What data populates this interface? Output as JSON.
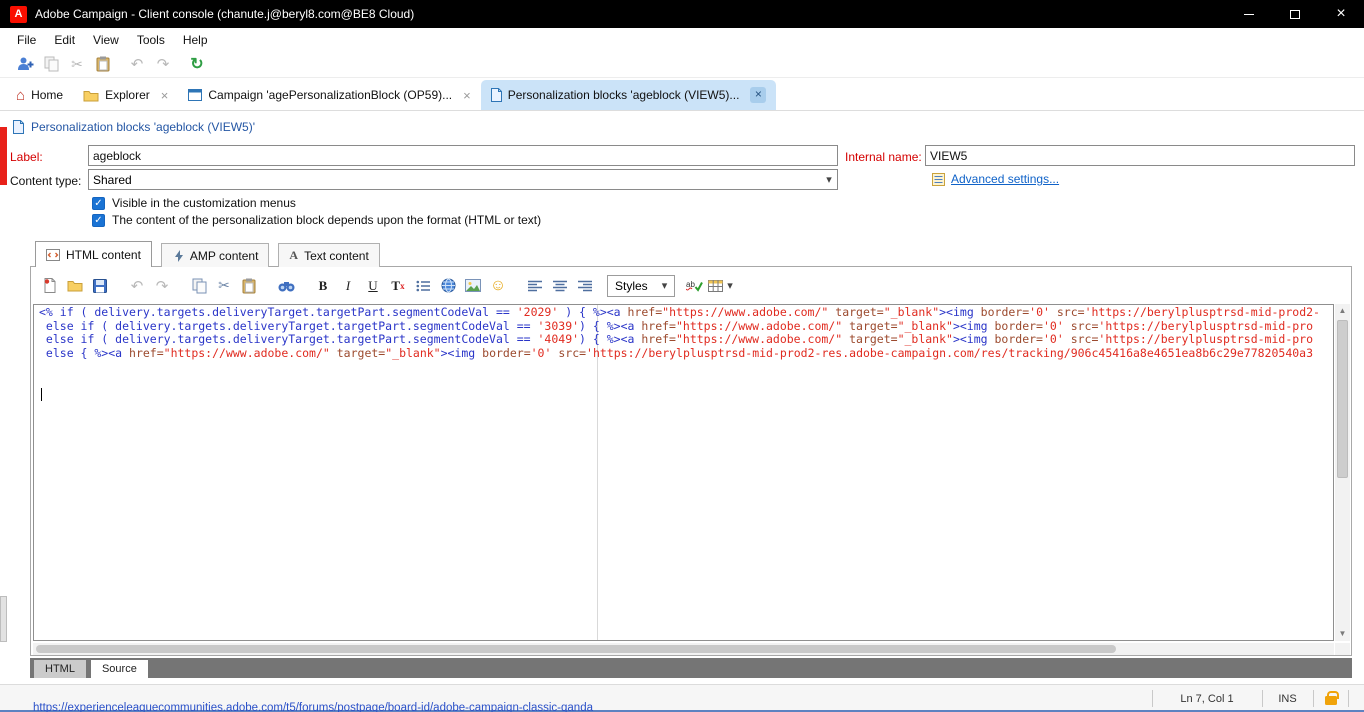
{
  "window": {
    "title": "Adobe Campaign - Client console (chanute.j@beryl8.com@BE8 Cloud)",
    "logo_letter": "A"
  },
  "menubar": {
    "items": [
      "File",
      "Edit",
      "View",
      "Tools",
      "Help"
    ]
  },
  "workspace_tabs": {
    "home": "Home",
    "explorer": "Explorer",
    "campaign": "Campaign 'agePersonalizationBlock (OP59)...",
    "personalization": "Personalization blocks 'ageblock (VIEW5)..."
  },
  "breadcrumb": {
    "title": "Personalization blocks 'ageblock (VIEW5)'"
  },
  "form": {
    "label_caption": "Label:",
    "label_value": "ageblock",
    "internal_name_caption": "Internal name:",
    "internal_name_value": "VIEW5",
    "content_type_caption": "Content type:",
    "content_type_value": "Shared",
    "advanced_settings_label": "Advanced settings...",
    "visible_checkbox_label": "Visible in the customization menus",
    "format_checkbox_label": "The content of the personalization block depends upon the format (HTML or text)"
  },
  "content_tabs": {
    "html": "HTML content",
    "amp": "AMP content",
    "text": "Text content"
  },
  "editor_toolbar": {
    "bold_label": "B",
    "italic_label": "I",
    "underline_label": "U",
    "remove_format_label": "T",
    "remove_format_sub": "x",
    "styles_label": "Styles"
  },
  "editor": {
    "caret": {
      "line": 7,
      "col": 1
    },
    "code_lines": [
      [
        {
          "c": "kw",
          "t": "<% if ( delivery.targets.deliveryTarget.targetPart.segmentCodeVal == "
        },
        {
          "c": "str",
          "t": "'2029'"
        },
        {
          "c": "kw",
          "t": " ) { %><a "
        },
        {
          "c": "attr",
          "t": "href="
        },
        {
          "c": "str",
          "t": "\"https://www.adobe.com/\""
        },
        {
          "c": "pl",
          "t": " "
        },
        {
          "c": "attr",
          "t": "target="
        },
        {
          "c": "str",
          "t": "\"_blank\""
        },
        {
          "c": "kw",
          "t": "><img "
        },
        {
          "c": "attr",
          "t": "border="
        },
        {
          "c": "str",
          "t": "'0'"
        },
        {
          "c": "pl",
          "t": " "
        },
        {
          "c": "attr",
          "t": "src="
        },
        {
          "c": "str",
          "t": "'https://berylplusptrsd-mid-prod2-"
        }
      ],
      [
        {
          "c": "kw",
          "t": " else if ( delivery.targets.deliveryTarget.targetPart.segmentCodeVal == "
        },
        {
          "c": "str",
          "t": "'3039'"
        },
        {
          "c": "kw",
          "t": ") { %><a "
        },
        {
          "c": "attr",
          "t": "href="
        },
        {
          "c": "str",
          "t": "\"https://www.adobe.com/\""
        },
        {
          "c": "pl",
          "t": " "
        },
        {
          "c": "attr",
          "t": "target="
        },
        {
          "c": "str",
          "t": "\"_blank\""
        },
        {
          "c": "kw",
          "t": "><img "
        },
        {
          "c": "attr",
          "t": "border="
        },
        {
          "c": "str",
          "t": "'0'"
        },
        {
          "c": "pl",
          "t": " "
        },
        {
          "c": "attr",
          "t": "src="
        },
        {
          "c": "str",
          "t": "'https://berylplusptrsd-mid-pro"
        }
      ],
      [
        {
          "c": "kw",
          "t": " else if ( delivery.targets.deliveryTarget.targetPart.segmentCodeVal == "
        },
        {
          "c": "str",
          "t": "'4049'"
        },
        {
          "c": "kw",
          "t": ") { %><a "
        },
        {
          "c": "attr",
          "t": "href="
        },
        {
          "c": "str",
          "t": "\"https://www.adobe.com/\""
        },
        {
          "c": "pl",
          "t": " "
        },
        {
          "c": "attr",
          "t": "target="
        },
        {
          "c": "str",
          "t": "\"_blank\""
        },
        {
          "c": "kw",
          "t": "><img "
        },
        {
          "c": "attr",
          "t": "border="
        },
        {
          "c": "str",
          "t": "'0'"
        },
        {
          "c": "pl",
          "t": " "
        },
        {
          "c": "attr",
          "t": "src="
        },
        {
          "c": "str",
          "t": "'https://berylplusptrsd-mid-pro"
        }
      ],
      [
        {
          "c": "kw",
          "t": " else { %><a "
        },
        {
          "c": "attr",
          "t": "href="
        },
        {
          "c": "str",
          "t": "\"https://www.adobe.com/\""
        },
        {
          "c": "pl",
          "t": " "
        },
        {
          "c": "attr",
          "t": "target="
        },
        {
          "c": "str",
          "t": "\"_blank\""
        },
        {
          "c": "kw",
          "t": "><img "
        },
        {
          "c": "attr",
          "t": "border="
        },
        {
          "c": "str",
          "t": "'0'"
        },
        {
          "c": "pl",
          "t": " "
        },
        {
          "c": "attr",
          "t": "src="
        },
        {
          "c": "str",
          "t": "'https://berylplusptrsd-mid-prod2-res.adobe-campaign.com/res/tracking/906c45416a8e4651ea8b6c29e77820540a3"
        }
      ],
      [],
      []
    ]
  },
  "view_tabs": {
    "html": "HTML",
    "source": "Source"
  },
  "statusbar": {
    "position": "Ln 7, Col 1",
    "insert_mode": "INS",
    "link_hint": "https://experienceleaguecommunities.adobe.com/t5/forums/postpage/board-id/adobe-campaign-classic-qanda"
  },
  "icons": {
    "close": "×",
    "home": "⌂",
    "scissors": "✂",
    "undo": "↶",
    "redo": "↷",
    "refresh": "↻",
    "chevron_down": "▾",
    "check": "✓",
    "smiley": "☺",
    "up_arrow": "▲",
    "down_arrow": "▼",
    "text_a": "A"
  },
  "colors": {
    "titlebar_bg": "#000000",
    "adobe_red": "#fa0f00",
    "active_tab_bg": "#cbe3f8",
    "label_red": "#d40000",
    "accent_red_bar": "#e8211a",
    "link_blue": "#0f62c8",
    "breadcrumb_blue": "#2456a4",
    "checkbox_blue": "#1a73d4",
    "code_keyword": "#2a35c8",
    "code_attribute": "#9c4a2e",
    "code_string": "#e02b20",
    "lock_orange": "#f0a30a"
  }
}
